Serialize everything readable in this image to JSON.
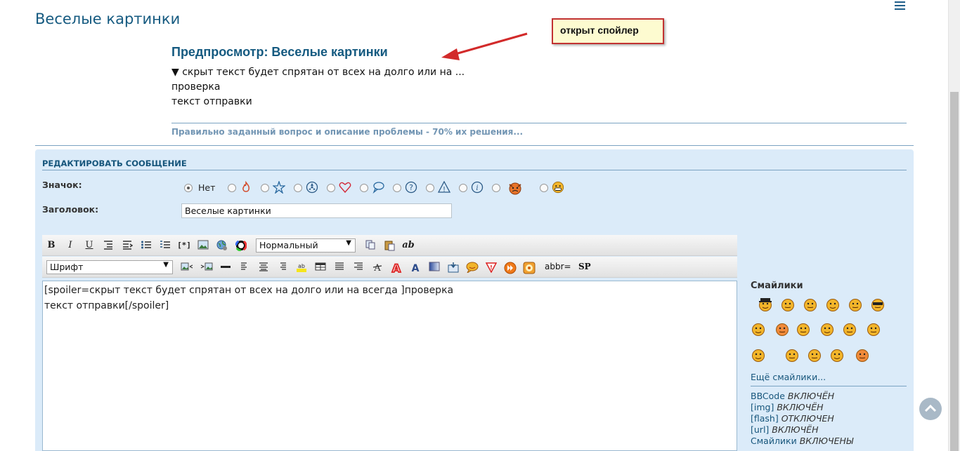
{
  "page": {
    "title": "Веселые картинки"
  },
  "preview": {
    "title": "Предпросмотр: Веселые картинки",
    "spoiler_marker": "▼",
    "spoiler_title": "скрыт текст будет спрятан от всех на долго или на ...",
    "line1": "проверка",
    "line2": "текст отправки",
    "signature": "Правильно заданный вопрос и описание проблемы - 70% их решения..."
  },
  "annotation": {
    "callout": "открыт спойлер",
    "color": "#d22a2a"
  },
  "edit": {
    "header": "РЕДАКТИРОВАТЬ СООБЩЕНИЕ",
    "icon_label": "Значок:",
    "icon_none_label": "Нет",
    "icons": [
      "fire-icon",
      "star-icon",
      "radiation-icon",
      "heart-icon",
      "speech-bubble-icon",
      "question-icon",
      "warning-icon",
      "info-icon",
      "angry-smiley-icon",
      "grin-smiley-icon"
    ],
    "title_label": "Заголовок:",
    "title_value": "Веселые картинки"
  },
  "toolbar": {
    "bold": "B",
    "italic": "I",
    "underline": "U",
    "size_select": "Нормальный",
    "font_select": "Шрифт",
    "list_tag": "[*]",
    "abbr": "abbr=",
    "sp": "SP",
    "ab": "ab"
  },
  "editor": {
    "content": "[spoiler=скрыт текст будет спрятан от всех на долго или на всегда ]проверка\nтекст отправки[/spoiler]"
  },
  "smilies": {
    "title": "Смайлики",
    "more": "Ещё смайлики...",
    "count": 17
  },
  "rules": [
    {
      "name": "BBCode",
      "state": "ВКЛЮЧЁН"
    },
    {
      "name": "[img]",
      "state": "ВКЛЮЧЁН"
    },
    {
      "name": "[flash]",
      "state": "ОТКЛЮЧЕН"
    },
    {
      "name": "[url]",
      "state": "ВКЛЮЧЁН"
    },
    {
      "name": "Смайлики",
      "state": "ВКЛЮЧЕНЫ"
    }
  ],
  "colors": {
    "accent": "#155a80",
    "panel": "#dbebf9",
    "link": "#17567c"
  }
}
